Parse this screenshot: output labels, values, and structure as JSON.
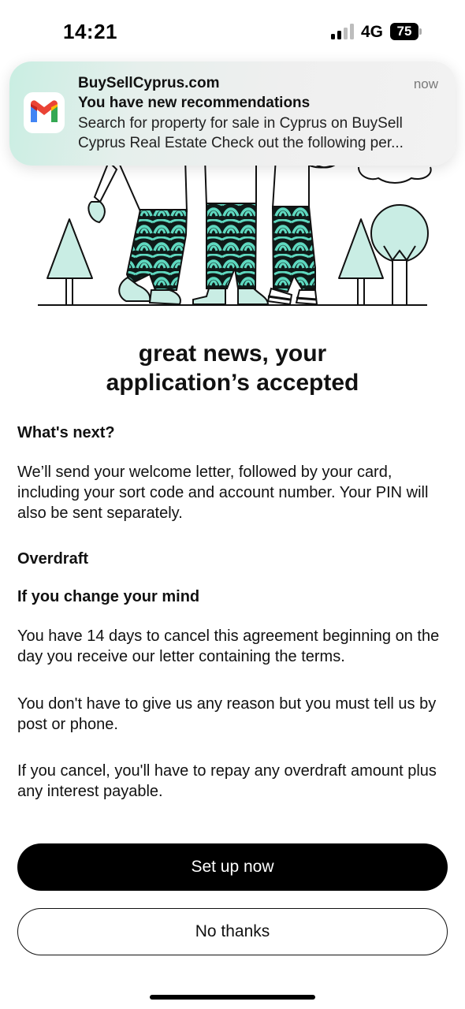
{
  "status_bar": {
    "time": "14:21",
    "network": "4G",
    "battery": "75"
  },
  "notification": {
    "app": "BuySellCyprus.com",
    "time": "now",
    "title": "You have new recommendations",
    "body": "Search for property for sale in Cyprus on BuySell Cyprus Real Estate Check out the following per...",
    "icon": "gmail-icon"
  },
  "main": {
    "headline_line1": "great news, your",
    "headline_line2": "application’s accepted",
    "whats_next_heading": "What's next?",
    "whats_next_text": "We’ll send your welcome letter, followed by your card, including your sort code and account number. Your PIN will also be sent separately.",
    "overdraft_heading": "Overdraft",
    "change_mind_heading": "If you change your mind",
    "cancel_para_1": "You have 14 days to cancel this agreement beginning on the day you receive our letter containing the terms.",
    "cancel_para_2": "You don't have to give us any reason but you must tell us by post or phone.",
    "cancel_para_3": "If you cancel, you'll have to repay any overdraft amount plus any interest payable."
  },
  "actions": {
    "primary_label": "Set up now",
    "secondary_label": "No thanks"
  },
  "colors": {
    "accent": "#5fd9c0",
    "primary_button": "#000000"
  }
}
